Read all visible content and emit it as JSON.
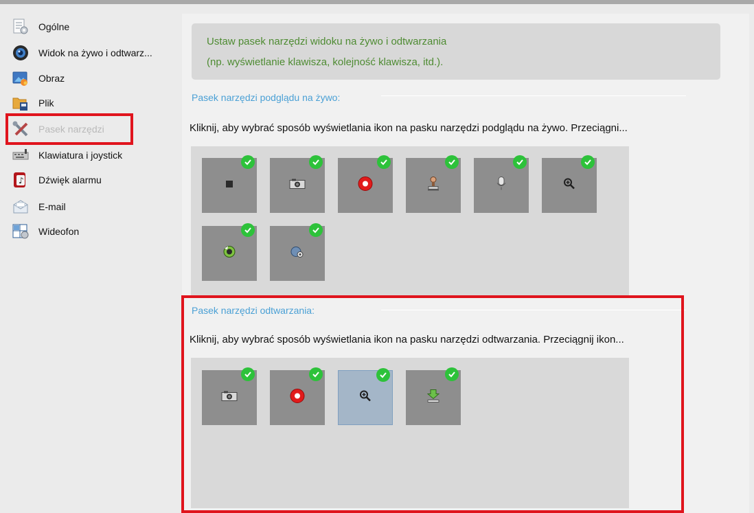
{
  "sidebar": {
    "items": [
      {
        "label": "Ogólne",
        "icon": "general-settings-icon"
      },
      {
        "label": "Widok na żywo i odtwarz...",
        "icon": "live-view-icon"
      },
      {
        "label": "Obraz",
        "icon": "image-icon"
      },
      {
        "label": "Plik",
        "icon": "file-folder-icon"
      },
      {
        "label": "Pasek narzędzi",
        "icon": "tools-icon",
        "state": "selected"
      },
      {
        "label": "Klawiatura i joystick",
        "icon": "keyboard-icon"
      },
      {
        "label": "Dźwięk alarmu",
        "icon": "alarm-sound-icon"
      },
      {
        "label": "E-mail",
        "icon": "email-icon"
      },
      {
        "label": "Wideofon",
        "icon": "video-intercom-icon"
      }
    ]
  },
  "description": {
    "line1": "Ustaw pasek narzędzi widoku na żywo i odtwarzania",
    "line2": "(np. wyświetlanie klawisza, kolejność klawisza, itd.)."
  },
  "live_toolbar": {
    "title": "Pasek narzędzi podglądu na żywo:",
    "text": "Kliknij, aby wybrać sposób wyświetlania ikon na pasku narzędzi podglądu na żywo. Przeciągni...",
    "tiles": [
      {
        "icon": "stop-icon",
        "checked": true
      },
      {
        "icon": "camera-capture-icon",
        "checked": true
      },
      {
        "icon": "record-icon",
        "checked": true
      },
      {
        "icon": "stamp-icon",
        "checked": true
      },
      {
        "icon": "microphone-icon",
        "checked": true
      },
      {
        "icon": "digital-zoom-icon",
        "checked": true
      },
      {
        "icon": "ptz-control-icon",
        "checked": true
      },
      {
        "icon": "settings-gear-icon",
        "checked": true
      }
    ]
  },
  "playback_toolbar": {
    "title": "Pasek narzędzi odtwarzania:",
    "text": "Kliknij, aby wybrać sposób wyświetlania ikon na pasku narzędzi odtwarzania. Przeciągnij ikon...",
    "tiles": [
      {
        "icon": "camera-capture-icon",
        "checked": true
      },
      {
        "icon": "record-icon",
        "checked": true
      },
      {
        "icon": "digital-zoom-icon",
        "checked": true,
        "selected": true
      },
      {
        "icon": "download-icon",
        "checked": true
      }
    ]
  },
  "colors": {
    "highlight": "#e0141d",
    "check": "#2dc23a",
    "section_title": "#4aa0d5",
    "description_text": "#4e8b32"
  }
}
